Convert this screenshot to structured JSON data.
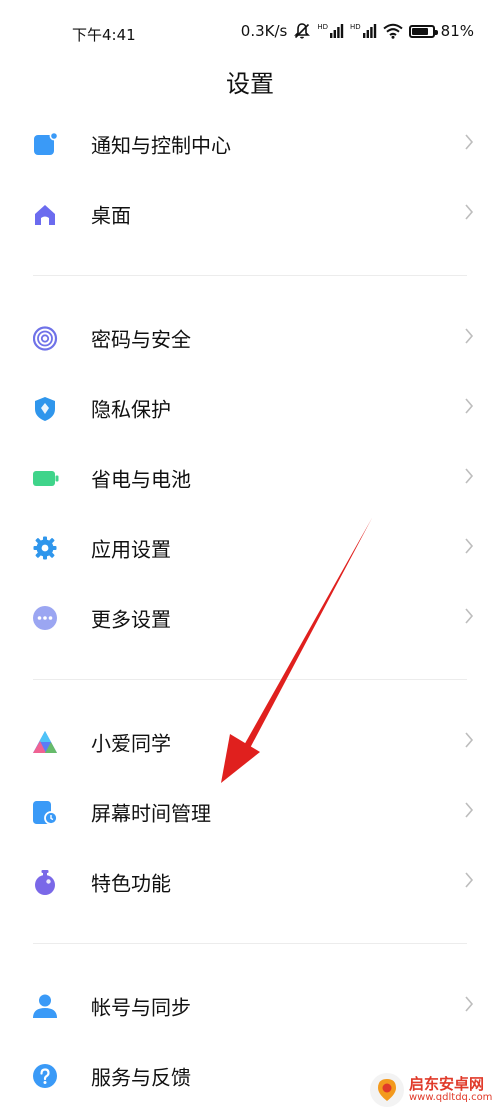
{
  "status_bar": {
    "time": "下午4:41",
    "net_speed": "0.3K/s",
    "hd_label_1": "HD",
    "hd_label_2": "HD",
    "battery_percent": "81%",
    "battery_level": 0.81
  },
  "header": {
    "title": "设置"
  },
  "sections": [
    {
      "items": [
        {
          "label": "通知与控制中心",
          "icon": "notification-icon",
          "color": "#3a9af7"
        },
        {
          "label": "桌面",
          "icon": "home-icon",
          "color": "#6b6bef"
        }
      ]
    },
    {
      "items": [
        {
          "label": "密码与安全",
          "icon": "fingerprint-icon",
          "color": "#6f72e8"
        },
        {
          "label": "隐私保护",
          "icon": "privacy-shield-icon",
          "color": "#2f96ec"
        },
        {
          "label": "省电与电池",
          "icon": "battery-icon",
          "color": "#3fd48a"
        },
        {
          "label": "应用设置",
          "icon": "gear-icon",
          "color": "#2f96ec"
        },
        {
          "label": "更多设置",
          "icon": "more-dots-icon",
          "color": "#9ba6f2"
        }
      ]
    },
    {
      "items": [
        {
          "label": "小爱同学",
          "icon": "xiaoai-icon",
          "color": "#5a7df5"
        },
        {
          "label": "屏幕时间管理",
          "icon": "screen-time-icon",
          "color": "#3a9af7"
        },
        {
          "label": "特色功能",
          "icon": "feature-potion-icon",
          "color": "#7a68e8"
        }
      ]
    },
    {
      "items": [
        {
          "label": "帐号与同步",
          "icon": "account-icon",
          "color": "#3a9af7"
        },
        {
          "label": "服务与反馈",
          "icon": "help-icon",
          "color": "#3a9af7"
        }
      ]
    }
  ],
  "watermark": {
    "name": "启东安卓网",
    "url": "www.qdltdq.com"
  },
  "colors": {
    "arrow": "#e0201e",
    "chevron": "#bdbdbd",
    "divider": "#ececec"
  }
}
